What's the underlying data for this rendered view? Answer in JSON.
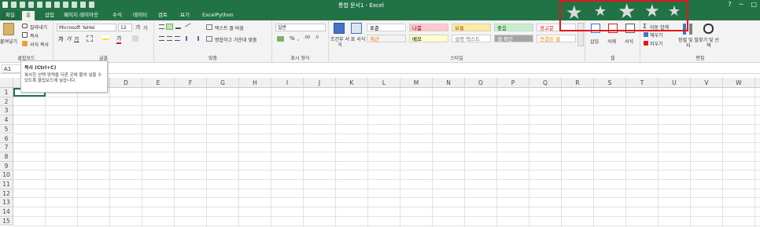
{
  "window": {
    "title": "통합 문서1 - Excel",
    "controls": [
      "?",
      "─",
      "□"
    ]
  },
  "tabs": [
    {
      "label": "파일",
      "active": false
    },
    {
      "label": "홈",
      "active": true
    },
    {
      "label": "삽입",
      "active": false
    },
    {
      "label": "페이지 레이아웃",
      "active": false
    },
    {
      "label": "수식",
      "active": false
    },
    {
      "label": "데이터",
      "active": false
    },
    {
      "label": "검토",
      "active": false
    },
    {
      "label": "보기",
      "active": false
    },
    {
      "label": "ExcelPython",
      "active": false
    }
  ],
  "ribbon": {
    "clipboard": {
      "paste_label": "붙여넣기",
      "cut_label": "잘라내기",
      "copy_label": "복사",
      "format_painter_label": "서식 복사",
      "group_label": "클립보드"
    },
    "font": {
      "font_name": "Microsoft YaHei",
      "font_size": "12",
      "group_label": "글꼴"
    },
    "alignment": {
      "wrap_text_label": "텍스트 줄 바꿈",
      "merge_label": "병합하고 가운데 맞춤",
      "group_label": "맞춤"
    },
    "number": {
      "format_value": "일반",
      "group_label": "표시 형식"
    },
    "styles": {
      "cond_format_label": "조건부 서식",
      "table_format_label": "표 서식",
      "cells": [
        {
          "label": "표준",
          "bg": "#ffffff",
          "fg": "#000000"
        },
        {
          "label": "나쁨",
          "bg": "#ffc7ce",
          "fg": "#9c0006"
        },
        {
          "label": "보통",
          "bg": "#ffeb9c",
          "fg": "#9c5700"
        },
        {
          "label": "좋음",
          "bg": "#c6efce",
          "fg": "#006100"
        },
        {
          "label": "경고문",
          "bg": "#ffffff",
          "fg": "#ff0000"
        },
        {
          "label": "계산",
          "bg": "#f2f2f2",
          "fg": "#fa7d00"
        },
        {
          "label": "메모",
          "bg": "#ffffcc",
          "fg": "#000000"
        },
        {
          "label": "설명 텍스트",
          "bg": "#ffffff",
          "fg": "#7f7f7f"
        },
        {
          "label": "셀 확인",
          "bg": "#a5a5a5",
          "fg": "#ffffff"
        },
        {
          "label": "연결된 셀",
          "bg": "#ffffff",
          "fg": "#fa7d00"
        }
      ],
      "group_label": "스타일"
    },
    "cells": {
      "insert_label": "삽입",
      "delete_label": "삭제",
      "format_label": "서식",
      "group_label": "셀"
    },
    "editing": {
      "autosum_label": "자동 합계",
      "fill_label": "채우기",
      "clear_label": "지우기",
      "sort_filter_label": "정렬 및 필터",
      "find_select_label": "찾기 및 선택",
      "group_label": "편집"
    }
  },
  "formula_bar": {
    "name_box": "A1",
    "formula": ""
  },
  "tooltip": {
    "title": "복사 (Ctrl+C)",
    "body": "복사한 선택 영역을 다른 곳에 붙여 넣을 수 있도록 클립보드에 넣습니다."
  },
  "sheet": {
    "columns": [
      "A",
      "B",
      "C",
      "D",
      "E",
      "F",
      "G",
      "H",
      "I",
      "J",
      "K",
      "L",
      "M",
      "N",
      "O",
      "P",
      "Q",
      "R",
      "S",
      "T",
      "U",
      "V",
      "W"
    ],
    "rows": [
      "1",
      "2",
      "3",
      "4",
      "5",
      "6",
      "7",
      "8",
      "9",
      "10",
      "11",
      "12",
      "13",
      "14",
      "15"
    ],
    "selected_cell": "A1"
  },
  "colors": {
    "brand": "#217346",
    "highlight_box": "#e0161c"
  }
}
